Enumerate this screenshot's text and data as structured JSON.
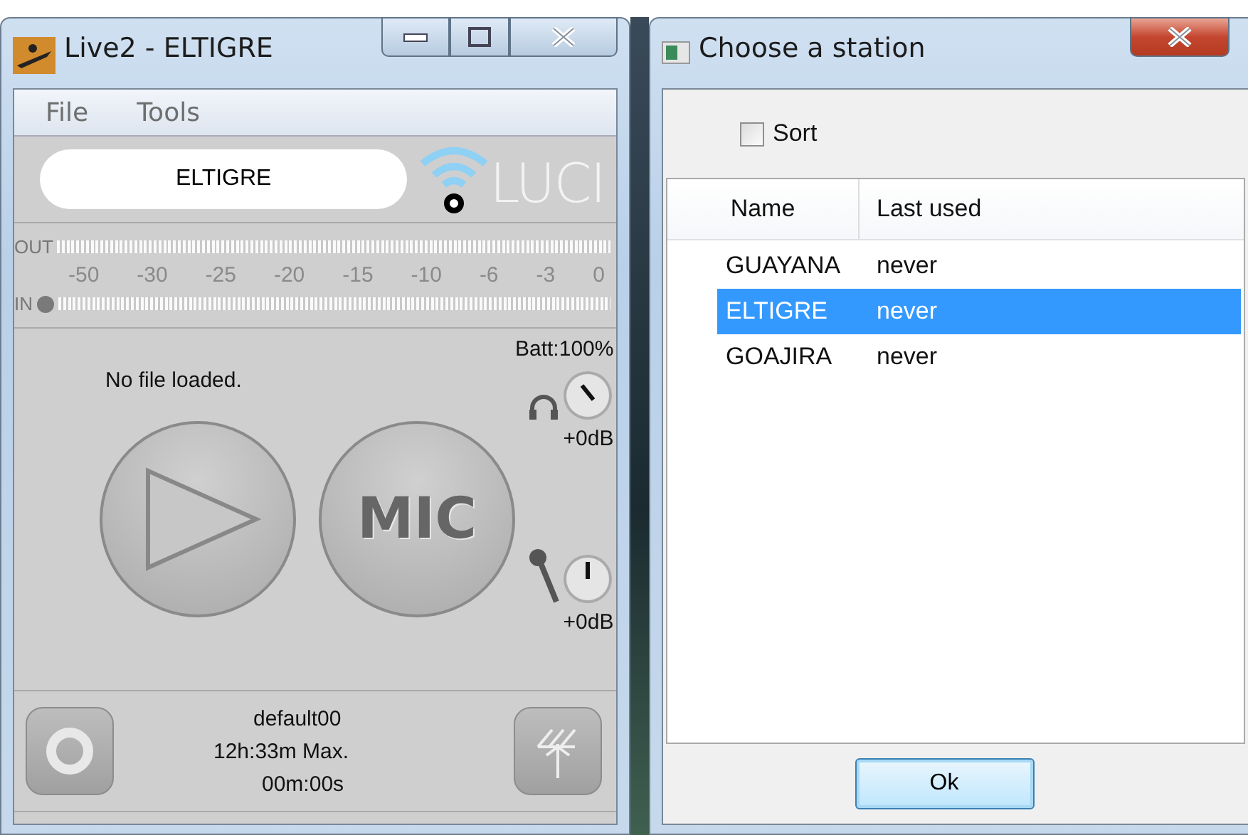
{
  "main_window": {
    "title": "Live2 - ELTIGRE",
    "menu": [
      "File",
      "Tools"
    ],
    "station": "ELTIGRE",
    "logo": "LUCI",
    "meter": {
      "out_label": "OUT",
      "in_label": "IN",
      "scale": [
        "-50",
        "-30",
        "-25",
        "-20",
        "-15",
        "-10",
        "-6",
        "-3",
        "0"
      ]
    },
    "file_status": "No file loaded.",
    "battery": "Batt:100%",
    "headphone_gain": "+0dB",
    "mic_gain": "+0dB",
    "mic_button": "MIC",
    "profile": "default00",
    "max_time": "12h:33m Max.",
    "elapsed": "00m:00s"
  },
  "dialog": {
    "title": "Choose a station",
    "sort": {
      "label": "Sort",
      "checked": false
    },
    "columns": [
      "Name",
      "Last used"
    ],
    "rows": [
      {
        "name": "GUAYANA",
        "last_used": "never",
        "selected": false
      },
      {
        "name": "ELTIGRE",
        "last_used": "never",
        "selected": true
      },
      {
        "name": "GOAJIRA",
        "last_used": "never",
        "selected": false
      }
    ],
    "buttons": [
      "Ok"
    ]
  }
}
